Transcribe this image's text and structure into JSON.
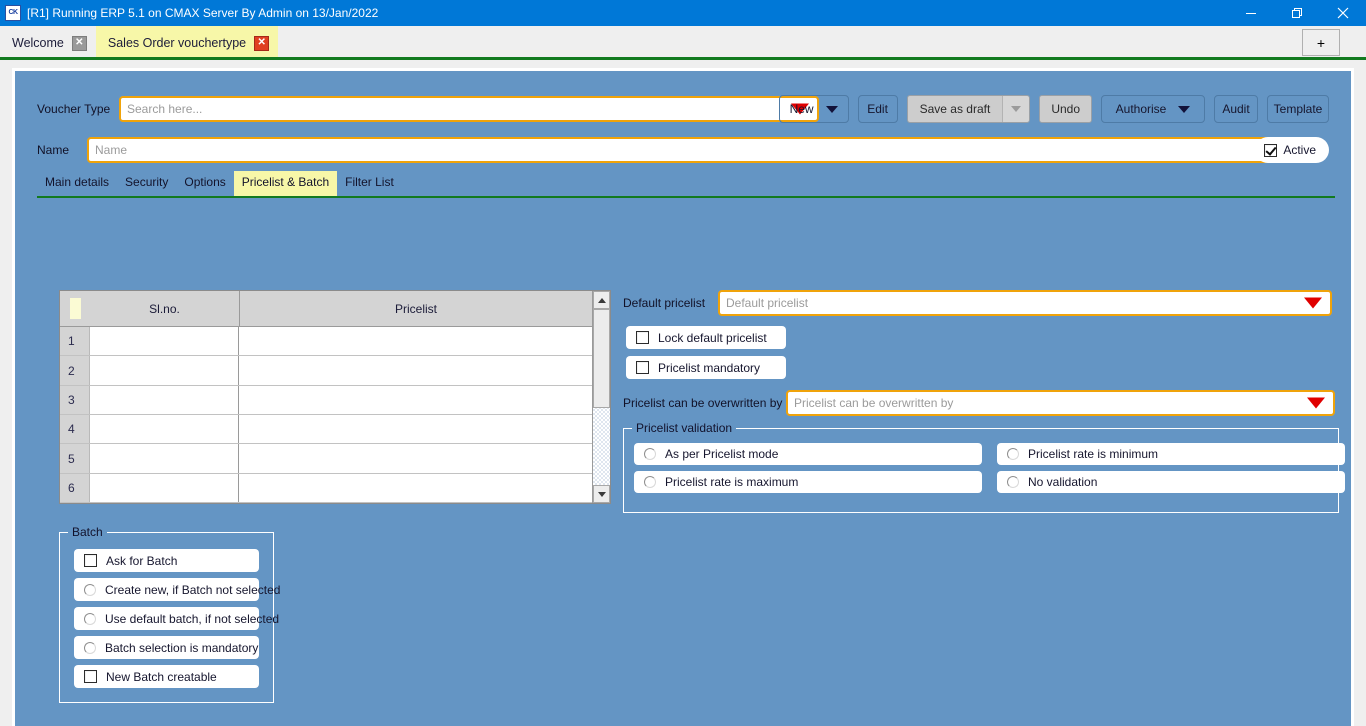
{
  "window": {
    "title": "[R1] Running ERP 5.1 on CMAX Server By Admin on 13/Jan/2022",
    "app_icon": "CK",
    "minimize_label": "—",
    "restore_label": "❐",
    "close_label": "✕"
  },
  "tabs": {
    "items": [
      {
        "label": "Welcome",
        "active": false,
        "close": "✕"
      },
      {
        "label": "Sales Order vouchertype",
        "active": true,
        "close": "✕"
      }
    ],
    "add_label": "+"
  },
  "header": {
    "voucher_type_label": "Voucher Type",
    "voucher_type_placeholder": "Search here...",
    "name_label": "Name",
    "name_placeholder": "Name",
    "active_label": "Active",
    "active_checked": true
  },
  "toolbar": {
    "new_label": "New",
    "edit_label": "Edit",
    "save_label": "Save as draft",
    "undo_label": "Undo",
    "authorise_label": "Authorise",
    "audit_label": "Audit",
    "template_label": "Template"
  },
  "subtabs": {
    "items": [
      {
        "label": "Main details",
        "active": false
      },
      {
        "label": "Security",
        "active": false
      },
      {
        "label": "Options",
        "active": false
      },
      {
        "label": "Pricelist & Batch",
        "active": true
      },
      {
        "label": "Filter List",
        "active": false
      }
    ]
  },
  "grid": {
    "columns": [
      "Sl.no.",
      "Pricelist"
    ],
    "rows": [
      {
        "num": "1",
        "slno": "",
        "pricelist": ""
      },
      {
        "num": "2",
        "slno": "",
        "pricelist": ""
      },
      {
        "num": "3",
        "slno": "",
        "pricelist": ""
      },
      {
        "num": "4",
        "slno": "",
        "pricelist": ""
      },
      {
        "num": "5",
        "slno": "",
        "pricelist": ""
      },
      {
        "num": "6",
        "slno": "",
        "pricelist": ""
      }
    ]
  },
  "pricelist": {
    "default_label": "Default pricelist",
    "default_placeholder": "Default pricelist",
    "lock_default_label": "Lock default pricelist",
    "lock_default_checked": false,
    "mandatory_label": "Pricelist  mandatory",
    "mandatory_checked": false,
    "overwritten_label": "Pricelist can be overwritten by",
    "overwritten_placeholder": "Pricelist can be overwritten by",
    "validation_title": "Pricelist validation",
    "validation_options": [
      {
        "label": "As per Pricelist mode",
        "selected": false
      },
      {
        "label": "Pricelist rate is minimum",
        "selected": false
      },
      {
        "label": "Pricelist rate is maximum",
        "selected": false
      },
      {
        "label": "No validation",
        "selected": false
      }
    ]
  },
  "batch": {
    "title": "Batch",
    "options": [
      {
        "label": "Ask for Batch",
        "type": "checkbox",
        "checked": false
      },
      {
        "label": "Create new, if Batch not selected",
        "type": "radio",
        "selected": false
      },
      {
        "label": "Use default batch, if not selected",
        "type": "radio",
        "selected": false
      },
      {
        "label": "Batch selection is mandatory",
        "type": "radio",
        "selected": false
      },
      {
        "label": "New Batch creatable",
        "type": "checkbox",
        "checked": false
      }
    ]
  },
  "colors": {
    "titlebar": "#0078d7",
    "panel_bg": "#6495c4",
    "accent_border": "#f0a30a",
    "active_tab": "#f7f7a8",
    "rule_green": "#127a1f",
    "caret_red": "#e00000"
  }
}
